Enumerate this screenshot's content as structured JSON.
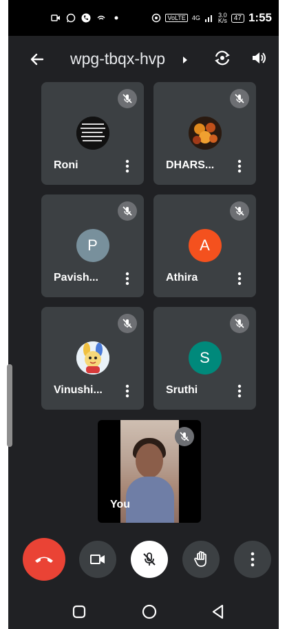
{
  "status_bar": {
    "left_icons": [
      "video-call-icon",
      "whatsapp-icon",
      "phone-icon",
      "wifi-call-icon",
      "dot-icon"
    ],
    "volte": "VoLTE",
    "network": "4G",
    "speed_top": "3.0",
    "speed_bottom": "K/s",
    "battery": "47",
    "time": "1:55"
  },
  "header": {
    "meeting_code": "wpg-tbqx-hvp"
  },
  "participants": [
    {
      "name": "Roni",
      "avatar_type": "image",
      "avatar_bg": "#000000"
    },
    {
      "name": "DHARS...",
      "avatar_type": "image",
      "avatar_bg": "#3a2a1a"
    },
    {
      "name": "Pavish...",
      "avatar_type": "initial",
      "initial": "P",
      "avatar_bg": "#78909c"
    },
    {
      "name": "Athira",
      "avatar_type": "initial",
      "initial": "A",
      "avatar_bg": "#f4511e"
    },
    {
      "name": "Vinushi...",
      "avatar_type": "image",
      "avatar_bg": "#e3f2fd"
    },
    {
      "name": "Sruthi",
      "avatar_type": "initial",
      "initial": "S",
      "avatar_bg": "#00897b"
    }
  ],
  "self_tile": {
    "label": "You"
  },
  "colors": {
    "background": "#202124",
    "tile": "#3c4043",
    "end_call": "#ea4335"
  }
}
